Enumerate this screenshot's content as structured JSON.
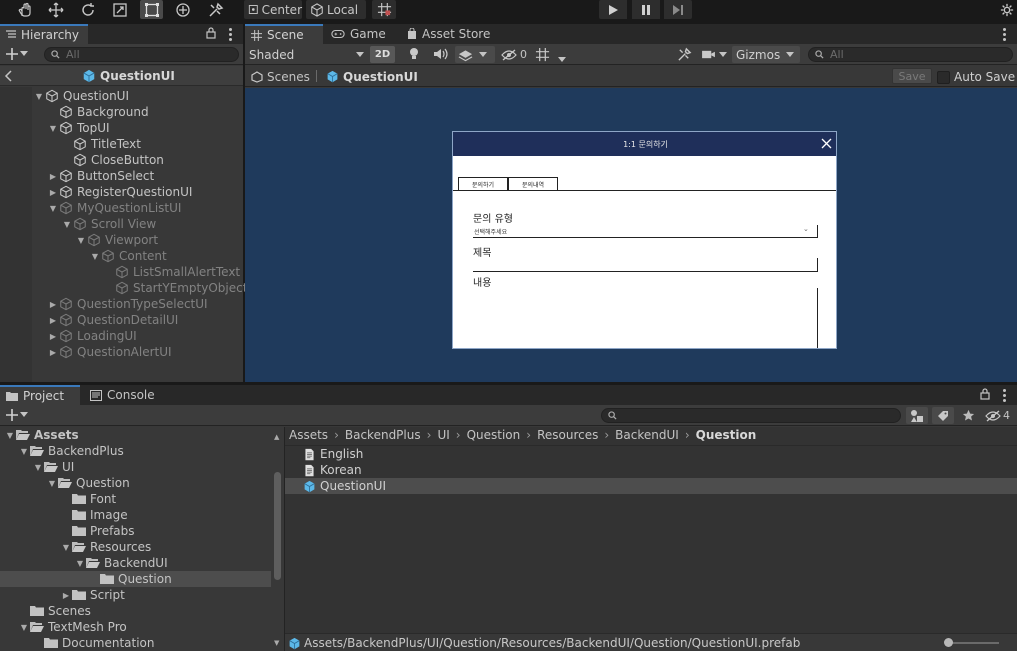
{
  "toolbar": {
    "pivot_center": "Center",
    "pivot_local": "Local"
  },
  "hierarchy": {
    "tab_label": "Hierarchy",
    "search_placeholder": "All",
    "root_title": "QuestionUI",
    "items": [
      {
        "label": "QuestionUI",
        "depth": 0,
        "fold": "open",
        "dim": false
      },
      {
        "label": "Background",
        "depth": 1,
        "fold": "none",
        "dim": false
      },
      {
        "label": "TopUI",
        "depth": 1,
        "fold": "open",
        "dim": false
      },
      {
        "label": "TitleText",
        "depth": 2,
        "fold": "none",
        "dim": false
      },
      {
        "label": "CloseButton",
        "depth": 2,
        "fold": "none",
        "dim": false
      },
      {
        "label": "ButtonSelect",
        "depth": 1,
        "fold": "closed",
        "dim": false
      },
      {
        "label": "RegisterQuestionUI",
        "depth": 1,
        "fold": "closed",
        "dim": false
      },
      {
        "label": "MyQuestionListUI",
        "depth": 1,
        "fold": "open",
        "dim": true
      },
      {
        "label": "Scroll View",
        "depth": 2,
        "fold": "open",
        "dim": true
      },
      {
        "label": "Viewport",
        "depth": 3,
        "fold": "open",
        "dim": true
      },
      {
        "label": "Content",
        "depth": 4,
        "fold": "open",
        "dim": true
      },
      {
        "label": "ListSmallAlertText",
        "depth": 5,
        "fold": "none",
        "dim": true
      },
      {
        "label": "StartYEmptyObject",
        "depth": 5,
        "fold": "none",
        "dim": true
      },
      {
        "label": "QuestionTypeSelectUI",
        "depth": 1,
        "fold": "closed",
        "dim": true
      },
      {
        "label": "QuestionDetailUI",
        "depth": 1,
        "fold": "closed",
        "dim": true
      },
      {
        "label": "LoadingUI",
        "depth": 1,
        "fold": "closed",
        "dim": true
      },
      {
        "label": "QuestionAlertUI",
        "depth": 1,
        "fold": "closed",
        "dim": true
      }
    ]
  },
  "scene": {
    "tabs": [
      "Scene",
      "Game",
      "Asset Store"
    ],
    "shading": "Shaded",
    "mode_2d": "2D",
    "hidden_count": "0",
    "gizmos": "Gizmos",
    "search_placeholder": "All",
    "breadcrumb_root": "Scenes",
    "breadcrumb_current": "QuestionUI",
    "save": "Save",
    "auto_save": "Auto Save",
    "dialog": {
      "title": "1:1 문의하기",
      "tab_1": "문의하기",
      "tab_2": "문의내역",
      "type_label": "문의 유형",
      "type_placeholder": "선택해주세요",
      "subject_label": "제목",
      "content_label": "내용"
    }
  },
  "project": {
    "tabs": [
      "Project",
      "Console"
    ],
    "hidden_count": "4",
    "tree": [
      {
        "label": "Assets",
        "depth": 0,
        "fold": "open",
        "bold": true
      },
      {
        "label": "BackendPlus",
        "depth": 1,
        "fold": "open"
      },
      {
        "label": "UI",
        "depth": 2,
        "fold": "open"
      },
      {
        "label": "Question",
        "depth": 3,
        "fold": "open"
      },
      {
        "label": "Font",
        "depth": 4,
        "fold": "none"
      },
      {
        "label": "Image",
        "depth": 4,
        "fold": "none"
      },
      {
        "label": "Prefabs",
        "depth": 4,
        "fold": "none"
      },
      {
        "label": "Resources",
        "depth": 4,
        "fold": "open"
      },
      {
        "label": "BackendUI",
        "depth": 5,
        "fold": "open"
      },
      {
        "label": "Question",
        "depth": 6,
        "fold": "none",
        "selected": true
      },
      {
        "label": "Script",
        "depth": 4,
        "fold": "closed"
      },
      {
        "label": "Scenes",
        "depth": 1,
        "fold": "none"
      },
      {
        "label": "TextMesh Pro",
        "depth": 1,
        "fold": "open"
      },
      {
        "label": "Documentation",
        "depth": 2,
        "fold": "none"
      }
    ],
    "path": [
      "Assets",
      "BackendPlus",
      "UI",
      "Question",
      "Resources",
      "BackendUI",
      "Question"
    ],
    "files": [
      {
        "label": "English",
        "kind": "text"
      },
      {
        "label": "Korean",
        "kind": "text"
      },
      {
        "label": "QuestionUI",
        "kind": "prefab",
        "selected": true
      }
    ],
    "status_path": "Assets/BackendPlus/UI/Question/Resources/BackendUI/Question/QuestionUI.prefab"
  },
  "colors": {
    "accent": "#3a79bb",
    "scene_bg": "#1f3a5c",
    "dialog_header": "#1f2f5a",
    "prefab_icon": "#5cb8e8",
    "selection": "#4d4d4d"
  }
}
